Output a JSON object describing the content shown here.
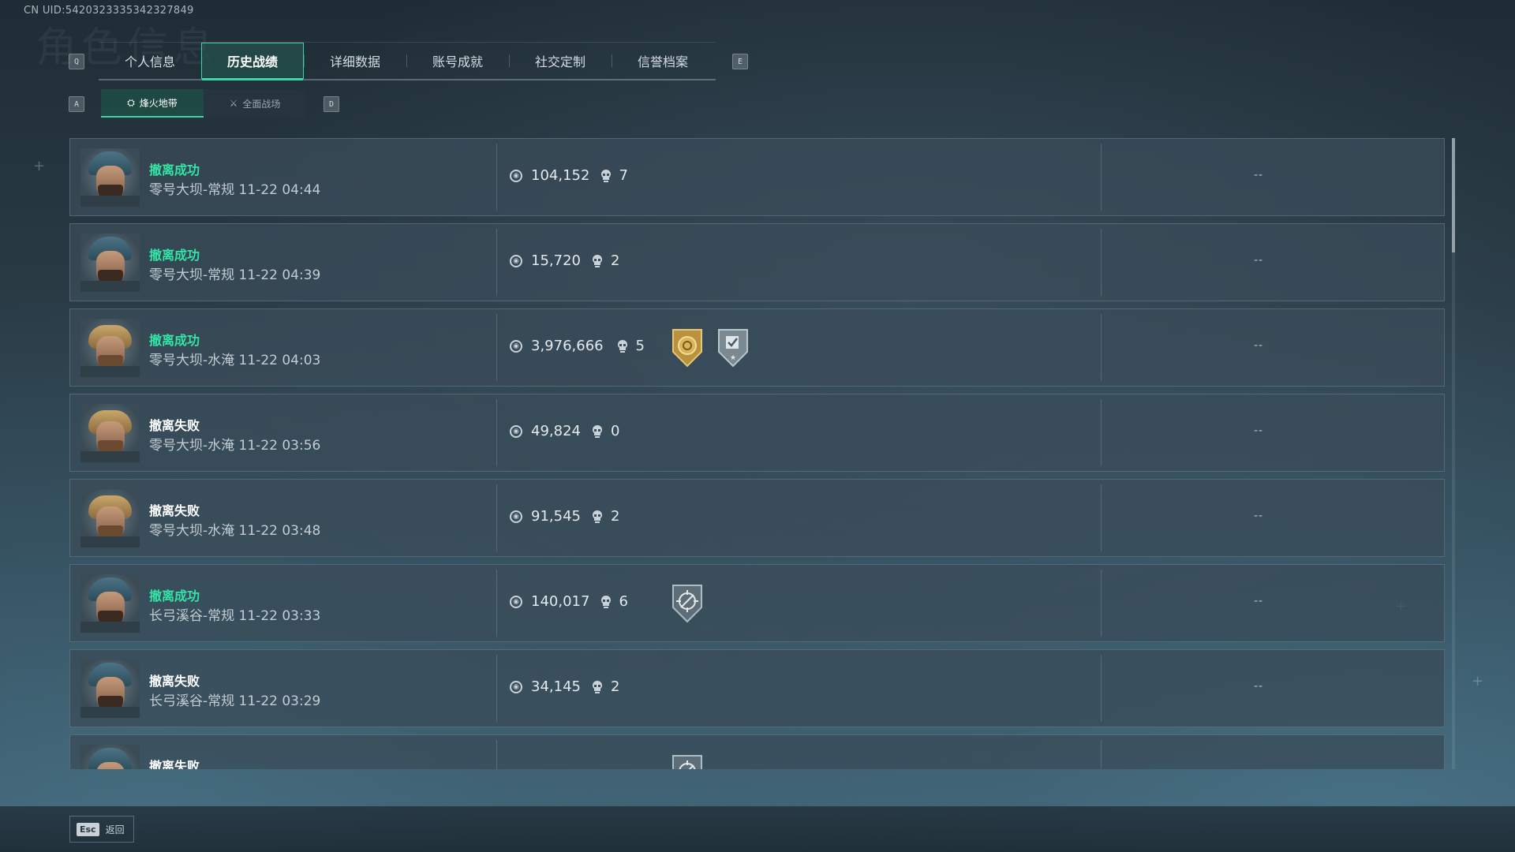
{
  "header": {
    "uid": "CN UID:5420323335342327849",
    "bg_title": "角色信息"
  },
  "tabs": {
    "prev_key": "Q",
    "next_key": "E",
    "items": [
      {
        "label": "个人信息"
      },
      {
        "label": "历史战绩",
        "active": true
      },
      {
        "label": "详细数据"
      },
      {
        "label": "账号成就"
      },
      {
        "label": "社交定制"
      },
      {
        "label": "信誉档案"
      }
    ]
  },
  "subtabs": {
    "prev_key": "A",
    "next_key": "D",
    "items": [
      {
        "label": "烽火地带",
        "icon": "hazard-zone-icon",
        "active": true
      },
      {
        "label": "全面战场",
        "icon": "warfare-icon"
      }
    ]
  },
  "matches": [
    {
      "status": "撤离成功",
      "success": true,
      "map": "零号大坝-常规",
      "time": "11-22 04:44",
      "value": "104,152",
      "kills": "7",
      "badges": [],
      "extra": "--",
      "avatar": "helmet"
    },
    {
      "status": "撤离成功",
      "success": true,
      "map": "零号大坝-常规",
      "time": "11-22 04:39",
      "value": "15,720",
      "kills": "2",
      "badges": [],
      "extra": "--",
      "avatar": "helmet"
    },
    {
      "status": "撤离成功",
      "success": true,
      "map": "零号大坝-水淹",
      "time": "11-22 04:03",
      "value": "3,976,666",
      "kills": "5",
      "badges": [
        "gold-coin-badge-icon",
        "silver-check-badge-icon"
      ],
      "extra": "--",
      "avatar": "blond"
    },
    {
      "status": "撤离失败",
      "success": false,
      "map": "零号大坝-水淹",
      "time": "11-22 03:56",
      "value": "49,824",
      "kills": "0",
      "badges": [],
      "extra": "--",
      "avatar": "blond"
    },
    {
      "status": "撤离失败",
      "success": false,
      "map": "零号大坝-水淹",
      "time": "11-22 03:48",
      "value": "91,545",
      "kills": "2",
      "badges": [],
      "extra": "--",
      "avatar": "blond"
    },
    {
      "status": "撤离成功",
      "success": true,
      "map": "长弓溪谷-常规",
      "time": "11-22 03:33",
      "value": "140,017",
      "kills": "6",
      "badges": [
        "crosshair-badge-icon"
      ],
      "extra": "--",
      "avatar": "helmet"
    },
    {
      "status": "撤离失败",
      "success": false,
      "map": "长弓溪谷-常规",
      "time": "11-22 03:29",
      "value": "34,145",
      "kills": "2",
      "badges": [],
      "extra": "--",
      "avatar": "helmet"
    },
    {
      "status": "撤离失败",
      "success": false,
      "map": "",
      "time": "",
      "value": "",
      "kills": "",
      "badges": [
        "crosshair-badge-icon"
      ],
      "extra": "",
      "avatar": "helmet"
    }
  ],
  "footer": {
    "esc_key": "Esc",
    "esc_label": "返回"
  },
  "colors": {
    "accent": "#3fd3a6",
    "success_text": "#34e3a6",
    "row_bg": "#3a4c58"
  }
}
